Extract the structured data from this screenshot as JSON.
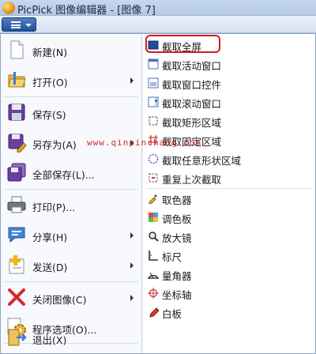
{
  "window": {
    "title": "PicPick 图像编辑器 - [图像 7]"
  },
  "left_menu": [
    {
      "label": "新建(N)",
      "icon": "new-document-icon",
      "submenu": false
    },
    {
      "label": "打开(O)",
      "icon": "folder-open-icon",
      "submenu": true
    },
    {
      "label": "保存(S)",
      "icon": "save-disk-icon",
      "submenu": false
    },
    {
      "label": "另存为(A)",
      "icon": "save-as-icon",
      "submenu": true
    },
    {
      "label": "全部保存(L)...",
      "icon": "save-all-icon",
      "submenu": false
    },
    {
      "label": "打印(P)...",
      "icon": "printer-icon",
      "submenu": false
    },
    {
      "label": "分享(H)",
      "icon": "share-icon",
      "submenu": true
    },
    {
      "label": "发送(D)",
      "icon": "send-icon",
      "submenu": true
    },
    {
      "label": "关闭图像(C)",
      "icon": "close-icon",
      "submenu": true
    },
    {
      "label": "程序选项(O)...",
      "icon": "options-gear-icon",
      "submenu": false
    },
    {
      "label": "退出(X)",
      "icon": "exit-icon",
      "submenu": false
    }
  ],
  "right_menu": [
    {
      "label": "截取全屏",
      "icon": "capture-fullscreen-icon",
      "highlighted": true
    },
    {
      "label": "截取活动窗口",
      "icon": "capture-active-window-icon"
    },
    {
      "label": "截取窗口控件",
      "icon": "capture-window-control-icon"
    },
    {
      "label": "截取滚动窗口",
      "icon": "capture-scrolling-window-icon"
    },
    {
      "label": "截取矩形区域",
      "icon": "capture-rectangle-icon"
    },
    {
      "label": "截取固定区域",
      "icon": "capture-fixed-region-icon"
    },
    {
      "label": "截取任意形状区域",
      "icon": "capture-freehand-icon"
    },
    {
      "label": "重复上次截取",
      "icon": "repeat-capture-icon"
    },
    {
      "label": "取色器",
      "icon": "color-picker-icon"
    },
    {
      "label": "调色板",
      "icon": "color-palette-icon"
    },
    {
      "label": "放大镜",
      "icon": "magnifier-icon"
    },
    {
      "label": "标尺",
      "icon": "ruler-icon"
    },
    {
      "label": "量角器",
      "icon": "protractor-icon"
    },
    {
      "label": "坐标轴",
      "icon": "crosshair-icon"
    },
    {
      "label": "白板",
      "icon": "whiteboard-pen-icon"
    }
  ],
  "watermark": "www.qinpinchang.com",
  "colors": {
    "accent": "#2c5fa8",
    "highlight_border": "#d81a1a"
  }
}
